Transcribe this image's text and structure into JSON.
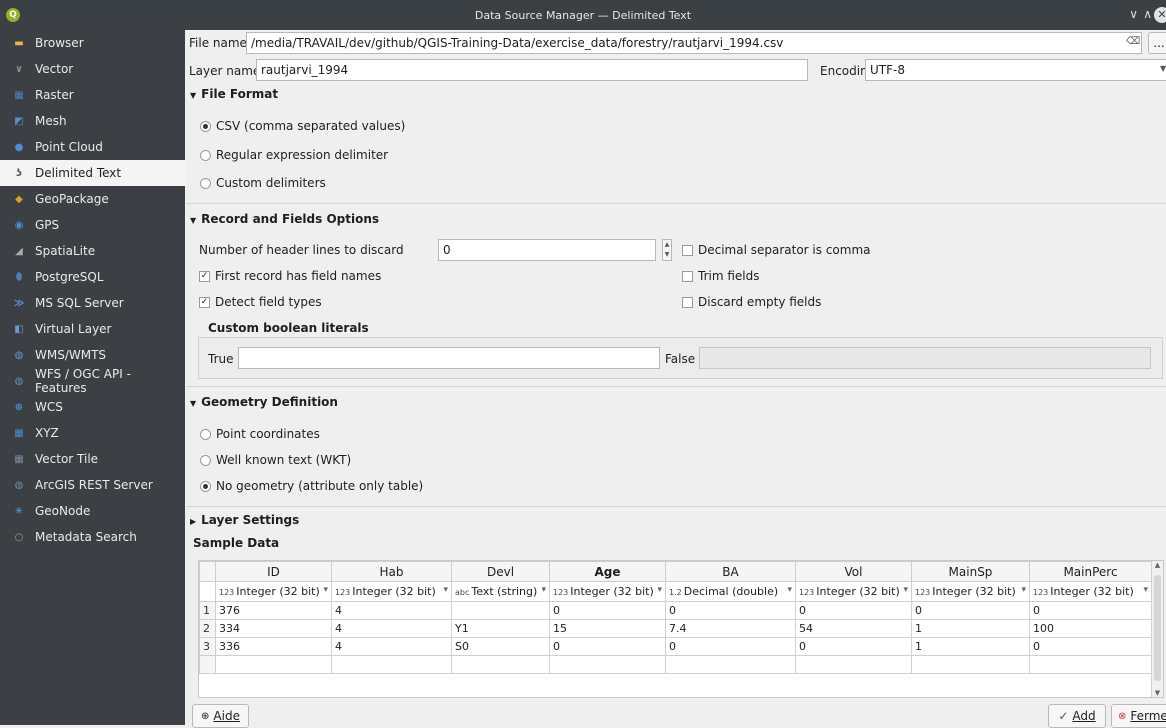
{
  "window": {
    "title": "Data Source Manager — Delimited Text"
  },
  "sidebar": {
    "items": [
      {
        "label": "Browser",
        "icon": "folder-icon",
        "color": "#f0b43c"
      },
      {
        "label": "Vector",
        "icon": "vector-icon",
        "color": "#8a8a8a"
      },
      {
        "label": "Raster",
        "icon": "raster-icon",
        "color": "#4f7fb8"
      },
      {
        "label": "Mesh",
        "icon": "mesh-icon",
        "color": "#5b8fd0"
      },
      {
        "label": "Point Cloud",
        "icon": "point-cloud-icon",
        "color": "#4a90d9"
      },
      {
        "label": "Delimited Text",
        "icon": "delimited-text-icon",
        "color": "#555555"
      },
      {
        "label": "GeoPackage",
        "icon": "geopackage-icon",
        "color": "#e0a020"
      },
      {
        "label": "GPS",
        "icon": "gps-icon",
        "color": "#4a90d9"
      },
      {
        "label": "SpatiaLite",
        "icon": "spatialite-icon",
        "color": "#a8a8a8"
      },
      {
        "label": "PostgreSQL",
        "icon": "postgresql-icon",
        "color": "#4a7fc0"
      },
      {
        "label": "MS SQL Server",
        "icon": "mssql-icon",
        "color": "#5a8fd8"
      },
      {
        "label": "Virtual Layer",
        "icon": "virtual-layer-icon",
        "color": "#6a9ad0"
      },
      {
        "label": "WMS/WMTS",
        "icon": "wms-icon",
        "color": "#5a9ad8"
      },
      {
        "label": "WFS / OGC API - Features",
        "icon": "wfs-icon",
        "color": "#6a8aa8"
      },
      {
        "label": "WCS",
        "icon": "wcs-icon",
        "color": "#4a8ad0"
      },
      {
        "label": "XYZ",
        "icon": "xyz-icon",
        "color": "#4a8ad0"
      },
      {
        "label": "Vector Tile",
        "icon": "vector-tile-icon",
        "color": "#7a8a9a"
      },
      {
        "label": "ArcGIS REST Server",
        "icon": "arcgis-icon",
        "color": "#6a8aa8"
      },
      {
        "label": "GeoNode",
        "icon": "geonode-icon",
        "color": "#4aa8d8"
      },
      {
        "label": "Metadata Search",
        "icon": "search-icon",
        "color": "#9a9a9a"
      }
    ]
  },
  "file": {
    "label": "File name",
    "value": "/media/TRAVAIL/dev/github/QGIS-Training-Data/exercise_data/forestry/rautjarvi_1994.csv",
    "browse_label": "..."
  },
  "layer": {
    "label": "Layer name",
    "value": "rautjarvi_1994",
    "encoding_label": "Encoding",
    "encoding_value": "UTF-8"
  },
  "file_format": {
    "title": "File Format",
    "options": [
      "CSV (comma separated values)",
      "Regular expression delimiter",
      "Custom delimiters"
    ],
    "selected": 0
  },
  "record_options": {
    "title": "Record and Fields Options",
    "header_lines_label": "Number of header lines to discard",
    "header_lines_value": "0",
    "decimal_comma": "Decimal separator is comma",
    "first_record": "First record has field names",
    "trim_fields": "Trim fields",
    "detect_types": "Detect field types",
    "discard_empty": "Discard empty fields",
    "boolean_title": "Custom boolean literals",
    "true_label": "True",
    "false_label": "False"
  },
  "geometry": {
    "title": "Geometry Definition",
    "options": [
      "Point coordinates",
      "Well known text (WKT)",
      "No geometry (attribute only table)"
    ],
    "selected": 2
  },
  "layer_settings": {
    "title": "Layer Settings"
  },
  "sample": {
    "title": "Sample Data",
    "columns": [
      "ID",
      "Hab",
      "Devl",
      "Age",
      "BA",
      "Vol",
      "MainSp",
      "MainPerc"
    ],
    "types": [
      {
        "badge": "123",
        "label": "Integer (32 bit)"
      },
      {
        "badge": "123",
        "label": "Integer (32 bit)"
      },
      {
        "badge": "abc",
        "label": "Text (string)"
      },
      {
        "badge": "123",
        "label": "Integer (32 bit)"
      },
      {
        "badge": "1.2",
        "label": "Decimal (double)"
      },
      {
        "badge": "123",
        "label": "Integer (32 bit)"
      },
      {
        "badge": "123",
        "label": "Integer (32 bit)"
      },
      {
        "badge": "123",
        "label": "Integer (32 bit)"
      }
    ],
    "rows": [
      [
        "1",
        "376",
        "4",
        "",
        "0",
        "0",
        "0",
        "0",
        "0"
      ],
      [
        "2",
        "334",
        "4",
        "Y1",
        "15",
        "7.4",
        "54",
        "1",
        "100"
      ],
      [
        "3",
        "336",
        "4",
        "S0",
        "0",
        "0",
        "0",
        "1",
        "0"
      ]
    ]
  },
  "buttons": {
    "help": "Aide",
    "add": "Add",
    "close": "Fermer"
  }
}
